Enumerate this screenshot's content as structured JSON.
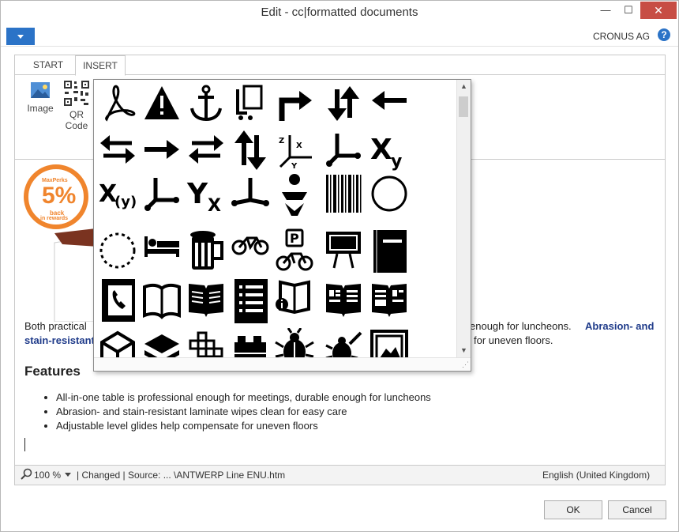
{
  "window": {
    "title": "Edit - cc|formatted documents",
    "minimize": "—",
    "maximize": "☐",
    "close": "✕"
  },
  "appbar": {
    "company": "CRONUS AG",
    "help": "?"
  },
  "tabs": {
    "start": "START",
    "insert": "INSERT"
  },
  "ribbon": {
    "image_label": "Image",
    "qr_label_1": "QR",
    "qr_label_2": "Code"
  },
  "logo": {
    "brand": "MaxPerks",
    "percent": "5%",
    "line1": "back",
    "line2": "in rewards"
  },
  "body": {
    "para1_start": "Both practical",
    "para1_end": "enough for luncheons.",
    "para1_blue_a": "Abrasion- and",
    "para2_blue": "stain-resistant",
    "para2_end": "for uneven floors.",
    "features_heading": "Features",
    "bullets": [
      "All-in-one table is professional enough for meetings, durable enough for luncheons",
      "Abrasion- and stain-resistant laminate wipes clean for easy care",
      "Adjustable level glides help compensate for uneven floors"
    ]
  },
  "status": {
    "zoom": "100 %",
    "changed": "| Changed |",
    "source": "Source: ... \\ANTWERP Line ENU.htm",
    "language": "English (United Kingdom)"
  },
  "buttons": {
    "ok": "OK",
    "cancel": "Cancel"
  },
  "icon_picker": {
    "icons": [
      "acrobat-icon",
      "warning-icon",
      "anchor-icon",
      "attach-document-icon",
      "turn-right-arrow-icon",
      "up-down-arrows-icon",
      "arrow-left-icon",
      "arrows-left-right-icon",
      "arrow-right-icon",
      "swap-arrows-icon",
      "up-down-swap-icon",
      "3d-axes-icon",
      "axis-icon",
      "x-sub-y-icon",
      "x-of-y-icon",
      "axis-branch-icon",
      "y-sub-x-icon",
      "axis-up-icon",
      "baby-change-icon",
      "barcode-icon",
      "circle-icon",
      "dashed-circle-icon",
      "bed-icon",
      "beer-icon",
      "bicycle-icon",
      "bicycle-parking-icon",
      "billboard-icon",
      "binder-icon",
      "phone-book-icon",
      "open-book-icon",
      "book-text-icon",
      "list-document-icon",
      "book-info-icon",
      "book-pages-icon",
      "newspaper-icon",
      "box-icon",
      "layers-icon",
      "grid-cross-icon",
      "brick-icon",
      "bug-icon",
      "bug-fix-icon",
      "image-frame-icon"
    ]
  },
  "colors": {
    "accent": "#2b73c7",
    "close_red": "#c74d44",
    "link_blue": "#1f3b8a",
    "logo_orange": "#f0852d"
  }
}
